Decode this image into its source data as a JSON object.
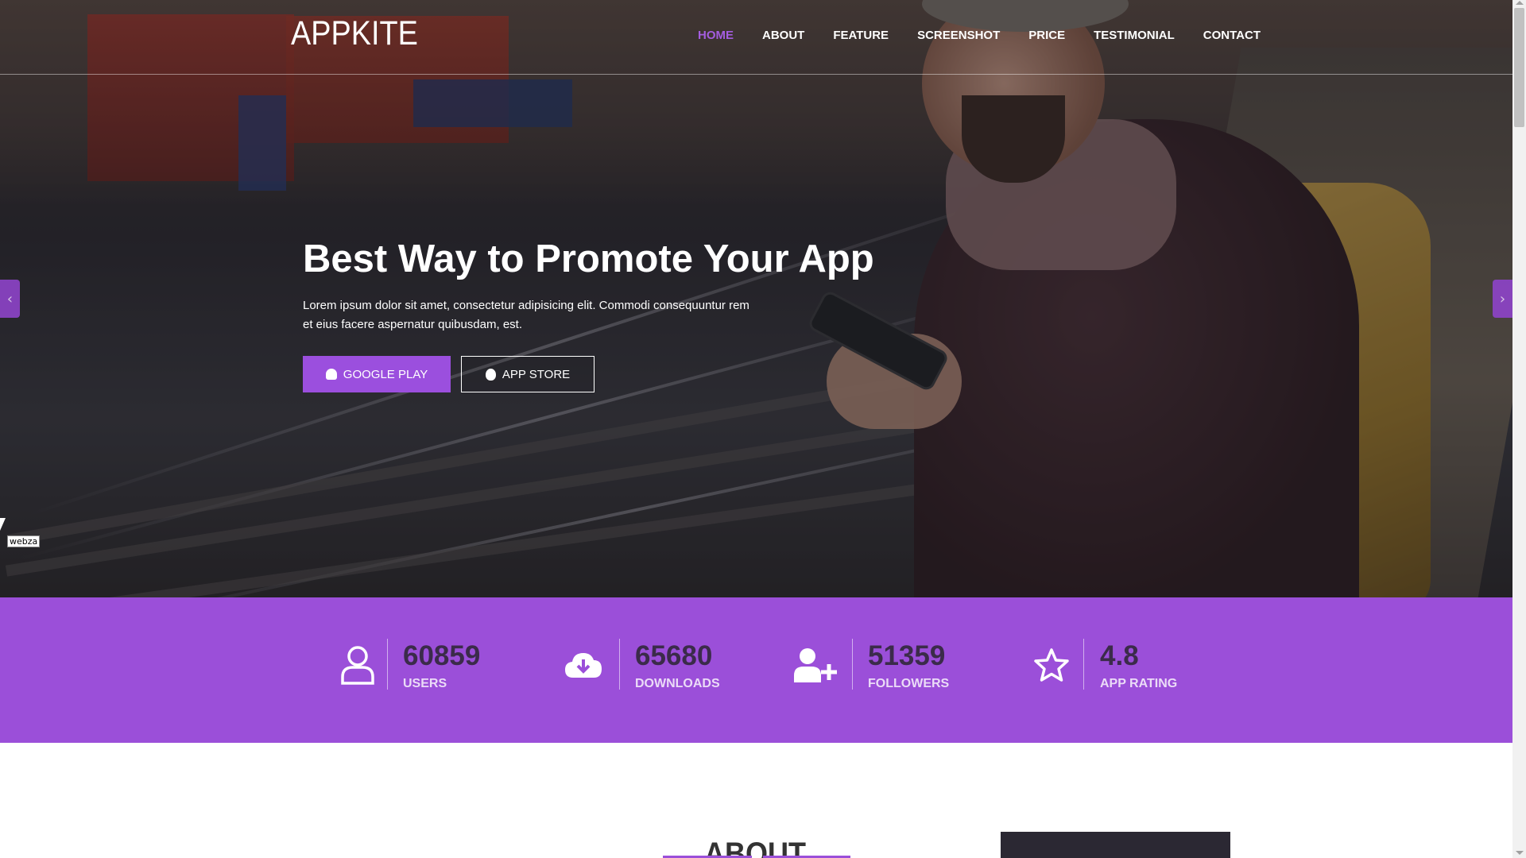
{
  "brand": {
    "logo": "APPKITE"
  },
  "nav": {
    "items": [
      {
        "label": "HOME",
        "active": true
      },
      {
        "label": "ABOUT",
        "active": false
      },
      {
        "label": "FEATURE",
        "active": false
      },
      {
        "label": "SCREENSHOT",
        "active": false
      },
      {
        "label": "PRICE",
        "active": false
      },
      {
        "label": "TESTIMONIAL",
        "active": false
      },
      {
        "label": "CONTACT",
        "active": false
      }
    ],
    "active_color": "#a45de0"
  },
  "hero": {
    "title": "Best Way to Promote Your App",
    "text": "Lorem ipsum dolor sit amet, consectetur adipisicing elit. Commodi consequuntur rem et eius facere aspernatur quibusdam, est.",
    "google_play_label": "GOOGLE PLAY",
    "app_store_label": "APP STORE",
    "prev_icon": "chevron-left-icon",
    "next_icon": "chevron-right-icon"
  },
  "cursor_tooltip": "webza",
  "stats": {
    "background": "#9b4fd9",
    "items": [
      {
        "icon": "user-icon",
        "number": "60859",
        "label": "USERS"
      },
      {
        "icon": "cloud-download-icon",
        "number": "65680",
        "label": "DOWNLOADS"
      },
      {
        "icon": "user-plus-icon",
        "number": "51359",
        "label": "FOLLOWERS"
      },
      {
        "icon": "star-icon",
        "number": "4.8",
        "label": "APP RATING"
      }
    ]
  },
  "about": {
    "title": "ABOUT"
  },
  "colors": {
    "accent": "#9b4fde",
    "dark_panel": "#2b2833"
  }
}
